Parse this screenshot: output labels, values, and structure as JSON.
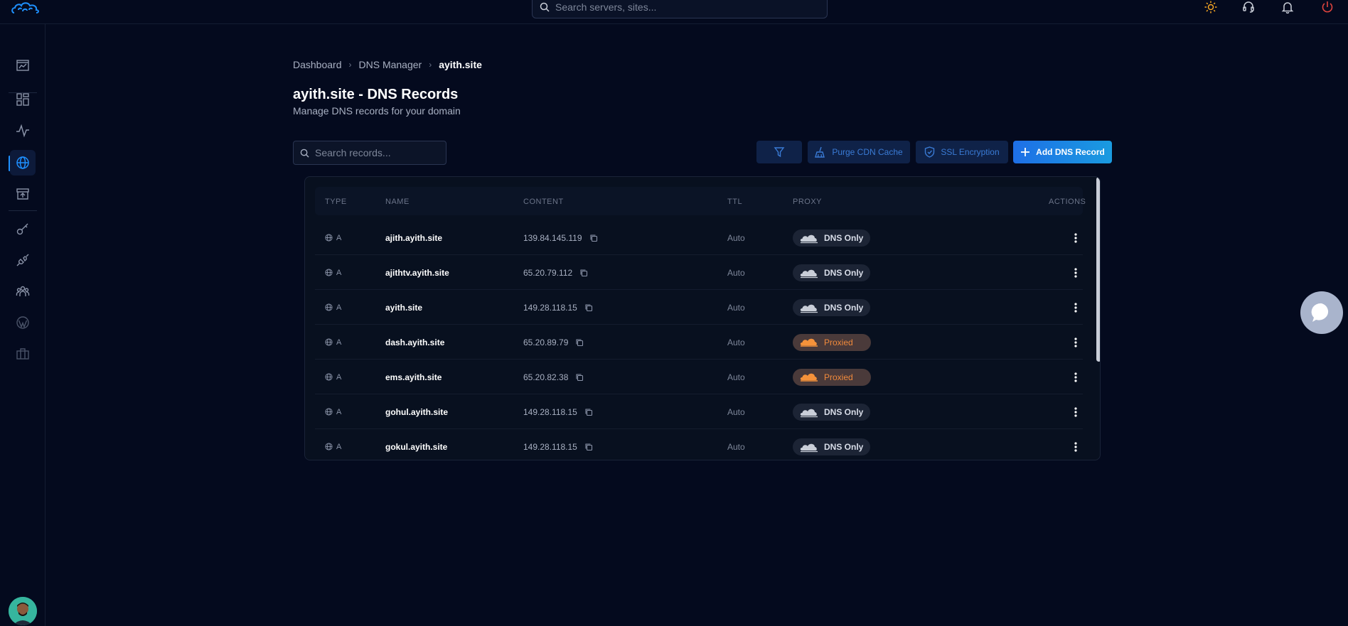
{
  "header": {
    "search_placeholder": "Search servers, sites...",
    "colors": {
      "theme": "#f5a623",
      "support": "#c9ced8",
      "bell": "#c9ced8",
      "power": "#e0443e"
    }
  },
  "sidebar": {
    "items": [
      {
        "name": "sidebar-item-overview",
        "icon": "chart-board-icon"
      },
      {
        "name": "sidebar-item-dashboard",
        "icon": "grid-icon"
      },
      {
        "name": "sidebar-item-monitoring",
        "icon": "activity-icon"
      },
      {
        "name": "sidebar-item-dns",
        "icon": "globe-icon",
        "active": true
      },
      {
        "name": "sidebar-item-storage",
        "icon": "archive-upload-icon"
      },
      {
        "name": "sidebar-item-keys",
        "icon": "key-icon"
      },
      {
        "name": "sidebar-item-integrations",
        "icon": "plug-icon"
      },
      {
        "name": "sidebar-item-team",
        "icon": "users-icon"
      },
      {
        "name": "sidebar-item-wordpress",
        "icon": "wordpress-icon"
      },
      {
        "name": "sidebar-item-services",
        "icon": "briefcase-icon"
      }
    ]
  },
  "breadcrumb": {
    "items": [
      "Dashboard",
      "DNS Manager"
    ],
    "current": "ayith.site"
  },
  "page": {
    "title": "ayith.site - DNS Records",
    "subtitle": "Manage DNS records for your domain"
  },
  "toolbar": {
    "search_placeholder": "Search records...",
    "purge_label": "Purge CDN Cache",
    "ssl_label": "SSL Encryption",
    "add_label": "Add DNS Record"
  },
  "table": {
    "headers": {
      "type": "TYPE",
      "name": "NAME",
      "content": "CONTENT",
      "ttl": "TTL",
      "proxy": "PROXY",
      "actions": "ACTIONS"
    },
    "rows": [
      {
        "type": "A",
        "name": "ajith.ayith.site",
        "content": "139.84.145.119",
        "ttl": "Auto",
        "proxy": "DNS Only",
        "proxied": false
      },
      {
        "type": "A",
        "name": "ajithtv.ayith.site",
        "content": "65.20.79.112",
        "ttl": "Auto",
        "proxy": "DNS Only",
        "proxied": false
      },
      {
        "type": "A",
        "name": "ayith.site",
        "content": "149.28.118.15",
        "ttl": "Auto",
        "proxy": "DNS Only",
        "proxied": false
      },
      {
        "type": "A",
        "name": "dash.ayith.site",
        "content": "65.20.89.79",
        "ttl": "Auto",
        "proxy": "Proxied",
        "proxied": true
      },
      {
        "type": "A",
        "name": "ems.ayith.site",
        "content": "65.20.82.38",
        "ttl": "Auto",
        "proxy": "Proxied",
        "proxied": true
      },
      {
        "type": "A",
        "name": "gohul.ayith.site",
        "content": "149.28.118.15",
        "ttl": "Auto",
        "proxy": "DNS Only",
        "proxied": false
      },
      {
        "type": "A",
        "name": "gokul.ayith.site",
        "content": "149.28.118.15",
        "ttl": "Auto",
        "proxy": "DNS Only",
        "proxied": false
      }
    ]
  },
  "colors": {
    "accent": "#1e90ff",
    "proxied": "#f08a3c",
    "background": "#040a1e"
  }
}
